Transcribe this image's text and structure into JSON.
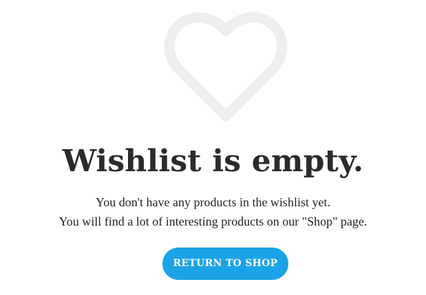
{
  "empty_state": {
    "icon": "heart-outline-icon",
    "icon_color": "#eeeeee",
    "title": "Wishlist is empty.",
    "message_line1": "You don't have any products in the wishlist yet.",
    "message_line2": "You will find a lot of interesting products on our \"Shop\" page.",
    "button_label": "RETURN TO SHOP",
    "button_color": "#1aa3e6"
  }
}
